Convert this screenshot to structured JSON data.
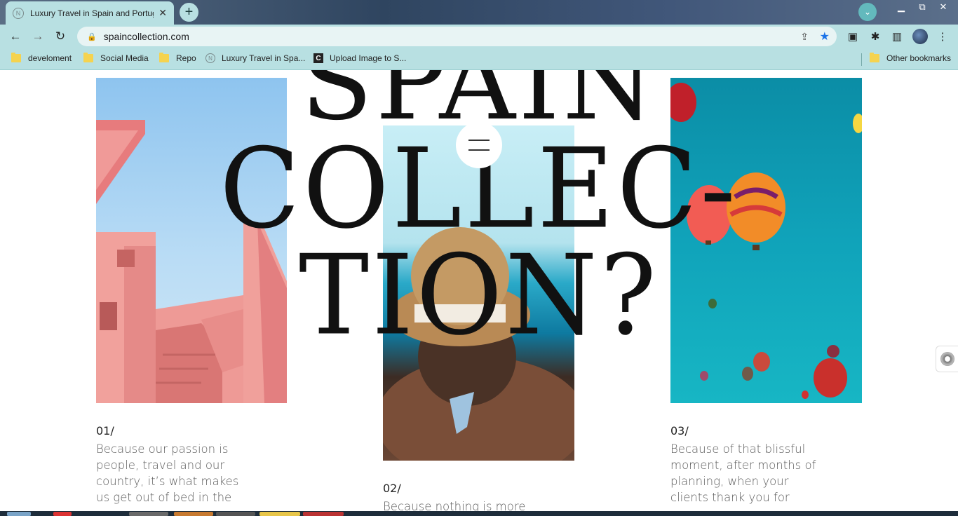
{
  "browser": {
    "tab_title": "Luxury Travel in Spain and Portugal",
    "tab_favicon": "N",
    "close_glyph": "✕",
    "new_tab_glyph": "+",
    "tab_search_glyph": "⌄",
    "window_buttons": [
      "▁",
      "⧉",
      "✕"
    ],
    "back_glyph": "←",
    "forward_glyph": "→",
    "reload_glyph": "↻",
    "lock_glyph": "🔒",
    "url": "spaincollection.com",
    "share_glyph": "⇪",
    "star_glyph": "★",
    "cast_glyph": "▣",
    "extensions_glyph": "✱",
    "sidepanel_glyph": "▥",
    "menu_glyph": "⋮"
  },
  "bookmarks": {
    "items": [
      {
        "label": "develoment",
        "icon": "folder-icon"
      },
      {
        "label": "Social Media",
        "icon": "folder-icon"
      },
      {
        "label": "Repo",
        "icon": "folder-icon"
      },
      {
        "label": "Luxury Travel in Spa...",
        "icon": "site-favicon"
      },
      {
        "label": "Upload Image to S...",
        "icon": "c-favicon"
      }
    ],
    "other": "Other bookmarks",
    "c_glyph": "C",
    "n_glyph": "N"
  },
  "page": {
    "headline_line1": "SPAIN",
    "headline_line2": "COLLEC-",
    "headline_line3": "TION?",
    "columns": [
      {
        "num": "01/",
        "text": "Because our passion is people, travel and our country, it’s what makes us get out of bed in the"
      },
      {
        "num": "02/",
        "text": "Because nothing is more"
      },
      {
        "num": "03/",
        "text": "Because of that blissful moment, after months of planning, when your clients thank you for"
      }
    ]
  },
  "colors": {
    "chrome_accent": "#b8e0e2",
    "star_blue": "#1a73e8",
    "headline": "#111111"
  }
}
